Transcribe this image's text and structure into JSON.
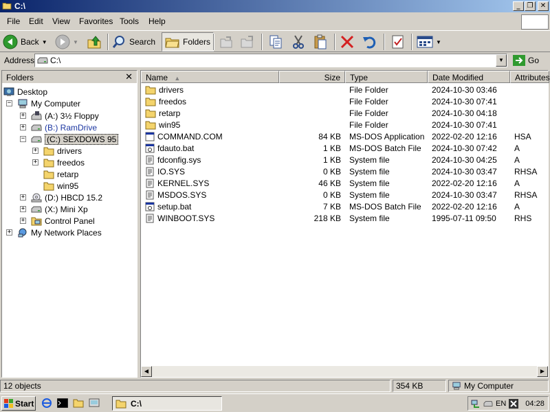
{
  "window": {
    "title": "C:\\"
  },
  "menu": [
    "File",
    "Edit",
    "View",
    "Favorites",
    "Tools",
    "Help"
  ],
  "toolbar": {
    "back_label": "Back",
    "search_label": "Search",
    "folders_label": "Folders"
  },
  "address": {
    "label": "Address",
    "value": "C:\\",
    "go_label": "Go"
  },
  "folders": {
    "title": "Folders",
    "close_glyph": "✕",
    "tree": [
      {
        "label": "Desktop"
      },
      {
        "label": "My Computer"
      },
      {
        "label": "(A:) 3½ Floppy"
      },
      {
        "label": "(B:) RamDrive"
      },
      {
        "label": "(C:) SEXDOWS 95"
      },
      {
        "label": "drivers"
      },
      {
        "label": "freedos"
      },
      {
        "label": "retarp"
      },
      {
        "label": "win95"
      },
      {
        "label": "(D:) HBCD 15.2"
      },
      {
        "label": "(X:) Mini Xp"
      },
      {
        "label": "Control Panel"
      },
      {
        "label": "My Network Places"
      }
    ]
  },
  "files": {
    "columns": {
      "name": "Name",
      "size": "Size",
      "type": "Type",
      "modified": "Date Modified",
      "attributes": "Attributes"
    },
    "rows": [
      {
        "name": "drivers",
        "size": "",
        "type": "File Folder",
        "modified": "2024-10-30 03:46",
        "attr": ""
      },
      {
        "name": "freedos",
        "size": "",
        "type": "File Folder",
        "modified": "2024-10-30 07:41",
        "attr": ""
      },
      {
        "name": "retarp",
        "size": "",
        "type": "File Folder",
        "modified": "2024-10-30 04:18",
        "attr": ""
      },
      {
        "name": "win95",
        "size": "",
        "type": "File Folder",
        "modified": "2024-10-30 07:41",
        "attr": ""
      },
      {
        "name": "COMMAND.COM",
        "size": "84 KB",
        "type": "MS-DOS Application",
        "modified": "2022-02-20 12:16",
        "attr": "HSA"
      },
      {
        "name": "fdauto.bat",
        "size": "1 KB",
        "type": "MS-DOS Batch File",
        "modified": "2024-10-30 07:42",
        "attr": "A"
      },
      {
        "name": "fdconfig.sys",
        "size": "1 KB",
        "type": "System file",
        "modified": "2024-10-30 04:25",
        "attr": "A"
      },
      {
        "name": "IO.SYS",
        "size": "0 KB",
        "type": "System file",
        "modified": "2024-10-30 03:47",
        "attr": "RHSA"
      },
      {
        "name": "KERNEL.SYS",
        "size": "46 KB",
        "type": "System file",
        "modified": "2022-02-20 12:16",
        "attr": "A"
      },
      {
        "name": "MSDOS.SYS",
        "size": "0 KB",
        "type": "System file",
        "modified": "2024-10-30 03:47",
        "attr": "RHSA"
      },
      {
        "name": "setup.bat",
        "size": "7 KB",
        "type": "MS-DOS Batch File",
        "modified": "2022-02-20 12:16",
        "attr": "A"
      },
      {
        "name": "WINBOOT.SYS",
        "size": "218 KB",
        "type": "System file",
        "modified": "1995-07-11 09:50",
        "attr": "RHS"
      }
    ]
  },
  "status": {
    "objects": "12 objects",
    "size": "354 KB",
    "location": "My Computer"
  },
  "taskbar": {
    "start_label": "Start",
    "window_label": "C:\\",
    "lang": "EN",
    "clock": "04:28"
  }
}
